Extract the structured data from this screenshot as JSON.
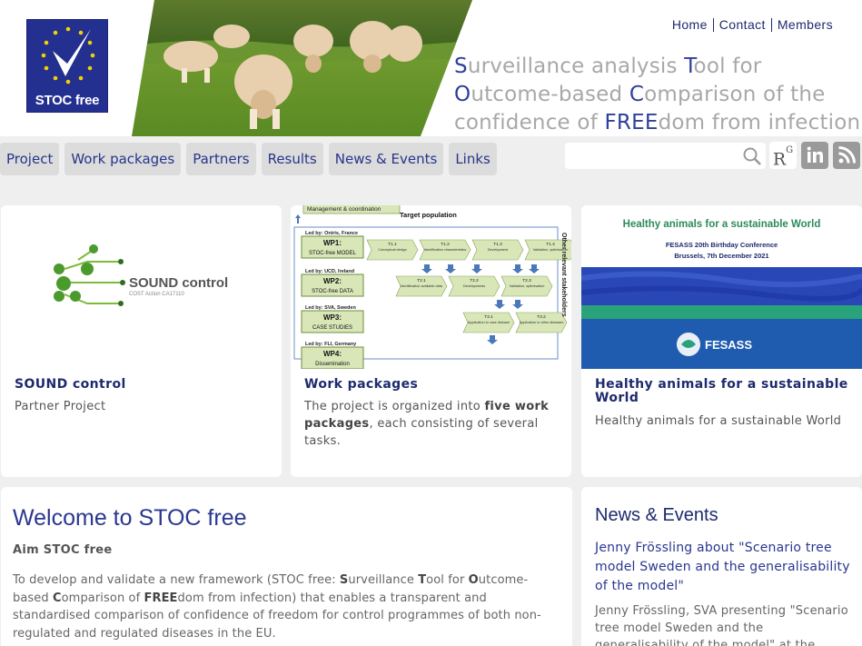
{
  "header": {
    "logo_text": "STOC free",
    "top_nav": [
      "Home",
      "Contact",
      "Members"
    ],
    "tagline": {
      "line1_hl": "S",
      "line1_rest": "urveillance analysis ",
      "line1_hl2": "T",
      "line1_rest2": "ool for",
      "line2_hl": "O",
      "line2_rest": "utcome-based ",
      "line2_hl2": "C",
      "line2_rest2": "omparison of the",
      "line3_pre": "confidence of ",
      "line3_hl": "FREE",
      "line3_rest": "dom from infection"
    }
  },
  "nav": {
    "items": [
      "Project",
      "Work packages",
      "Partners",
      "Results",
      "News & Events",
      "Links"
    ],
    "search_placeholder": "",
    "rg_label": "R",
    "rg_sup": "G"
  },
  "cards": [
    {
      "title": "SOUND control",
      "text": "Partner Project",
      "image_title": "SOUND control",
      "image_sub": "COST Action CA17110"
    },
    {
      "title": "Work packages",
      "text_pre": "The project is organized into ",
      "text_bold": "five work packages",
      "text_post": ", each consisting of several tasks.",
      "diagram": {
        "header": "Management & coordination",
        "target": "Target population",
        "side": "Other relevant stakeholders",
        "wps": [
          {
            "led": "Led by: Oniris, France",
            "name": "WP1:",
            "sub": "STOC-free MODEL"
          },
          {
            "led": "Led by: UCD, Ireland",
            "name": "WP2:",
            "sub": "STOC-free DATA"
          },
          {
            "led": "Led by: SVA, Sweden",
            "name": "WP3:",
            "sub": "CASE STUDIES"
          },
          {
            "led": "Led by: FLI, Germany",
            "name": "WP4:",
            "sub": "Dissemination"
          }
        ],
        "row1": [
          {
            "id": "T1.1",
            "t": "Conceptual design"
          },
          {
            "id": "T1.2",
            "t": "Identification characteristics"
          },
          {
            "id": "T1.3",
            "t": "Development"
          },
          {
            "id": "T1.4",
            "t": "Validation, optimisation"
          }
        ],
        "row2": [
          {
            "id": "T2.1",
            "t": "Identification available data"
          },
          {
            "id": "T2.2",
            "t": "Developments"
          },
          {
            "id": "T2.3",
            "t": "Validation, optimisation"
          }
        ],
        "row3": [
          {
            "id": "T3.1",
            "t": "Application to case disease"
          },
          {
            "id": "T3.2",
            "t": "Application to other diseases"
          }
        ]
      }
    },
    {
      "title": "Healthy animals for a sustainable World",
      "text": "Healthy animals for a sustainable World",
      "image_title": "Healthy animals for a sustainable World",
      "image_sub1": "FESASS 20th Birthday Conference",
      "image_sub2": "Brussels, 7th December 2021",
      "image_brand": "FESASS"
    }
  ],
  "welcome": {
    "title": "Welcome to STOC free",
    "aim": "Aim STOC free",
    "p_1": "To develop and validate a new framework (STOC free: ",
    "p_S": "S",
    "p_2": "urveillance ",
    "p_T": "T",
    "p_3": "ool for ",
    "p_O": "O",
    "p_4": "utcome-based ",
    "p_C": "C",
    "p_5": "omparison of ",
    "p_FREE": "FREE",
    "p_6": "dom from infection) that enables a transparent and standardised comparison of confidence of freedom for control programmes of both non-regulated and regulated diseases in the EU."
  },
  "news": {
    "title": "News & Events",
    "link": "Jenny Frössling about \"Scenario tree model Sweden and the generalisability of the model\"",
    "desc": "Jenny Frössling, SVA presenting \"Scenario tree model Sweden and the generalisability of the model\" at the \"STOC free decision"
  },
  "icons": [
    "search-icon",
    "researchgate-icon",
    "linkedin-icon",
    "rss-icon"
  ],
  "colors": {
    "brand": "#23308f",
    "link": "#1e2a6e",
    "nav_bg": "#dcdcdc",
    "page_bg": "#efefef"
  }
}
